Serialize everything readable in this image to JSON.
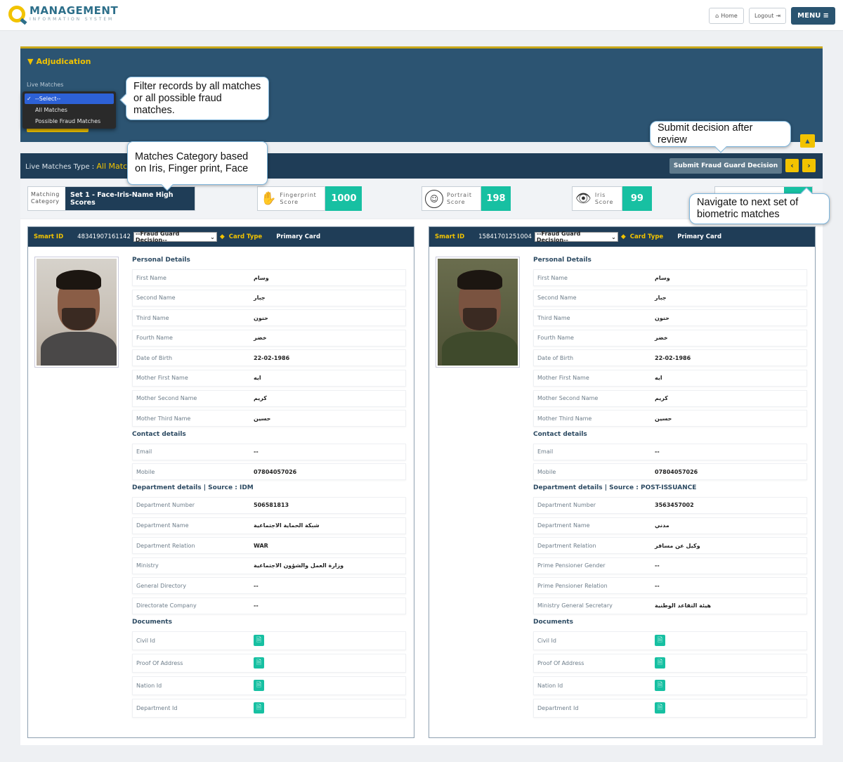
{
  "header": {
    "logo_main": "MANAGEMENT",
    "logo_sub": "INFORMATION SYSTEM",
    "home_label": "Home",
    "logout_label": "Logout",
    "menu_label": "MENU"
  },
  "adjudication": {
    "title": "Adjudication",
    "live_matches_label": "Live Matches",
    "dropdown_options": [
      "--Select--",
      "All Matches",
      "Possible Fraud Matches"
    ],
    "selected_option": "--Select--"
  },
  "live_bar": {
    "type_label": "Live Matches Type : ",
    "type_value": "All Matches",
    "submit_label": "Submit Fraud Guard Decision",
    "prev_icon": "chevron-left",
    "next_icon": "chevron-right"
  },
  "scores": {
    "matching_category_label": "Matching Category",
    "matching_category_value": "Set 1 - Face-Iris-Name High Scores",
    "fingerprint_label": "Fingerprint Score",
    "fingerprint_value": "1000",
    "portrait_label": "Portrait Score",
    "portrait_value": "198",
    "iris_label": "Iris Score",
    "iris_value": "99"
  },
  "callouts": {
    "filter": "Filter records by all matches or all possible fraud matches.",
    "category": "Matches Category based on Iris, Finger print, Face",
    "submit": "Submit decision after review",
    "navigate": "Navigate to next set of biometric matches"
  },
  "records": [
    {
      "smart_id_label": "Smart ID",
      "smart_id": "48341907161142",
      "decision": "--Fraud Guard Decision--",
      "card_type_label": "Card Type",
      "card_type": "Primary Card",
      "personal_title": "Personal Details",
      "personal": [
        {
          "label": "First Name",
          "value": "وسام"
        },
        {
          "label": "Second Name",
          "value": "جبار"
        },
        {
          "label": "Third Name",
          "value": "حنون"
        },
        {
          "label": "Fourth Name",
          "value": "خضر"
        },
        {
          "label": "Date of Birth",
          "value": "22-02-1986"
        },
        {
          "label": "Mother First Name",
          "value": "ايه"
        },
        {
          "label": "Mother Second Name",
          "value": "كريم"
        },
        {
          "label": "Mother Third Name",
          "value": "حسين"
        }
      ],
      "contact_title": "Contact details",
      "contact": [
        {
          "label": "Email",
          "value": "--"
        },
        {
          "label": "Mobile",
          "value": "07804057026"
        }
      ],
      "department_title": "Department details | Source : IDM",
      "department": [
        {
          "label": "Department Number",
          "value": "506581813"
        },
        {
          "label": "Department Name",
          "value": "شبكة الحماية الاجتماعية"
        },
        {
          "label": "Department Relation",
          "value": "WAR"
        },
        {
          "label": "Ministry",
          "value": "وزارة العمل والشؤون الاجتماعية"
        },
        {
          "label": "General Directory",
          "value": "--"
        },
        {
          "label": "Directorate Company",
          "value": "--"
        }
      ],
      "documents_title": "Documents",
      "documents": [
        {
          "label": "Civil Id"
        },
        {
          "label": "Proof Of Address"
        },
        {
          "label": "Nation Id"
        },
        {
          "label": "Department Id"
        }
      ]
    },
    {
      "smart_id_label": "Smart ID",
      "smart_id": "15841701251004",
      "decision": "--Fraud Guard Decision--",
      "card_type_label": "Card Type",
      "card_type": "Primary Card",
      "personal_title": "Personal Details",
      "personal": [
        {
          "label": "First Name",
          "value": "وسام"
        },
        {
          "label": "Second Name",
          "value": "جبار"
        },
        {
          "label": "Third Name",
          "value": "حنون"
        },
        {
          "label": "Fourth Name",
          "value": "خضر"
        },
        {
          "label": "Date of Birth",
          "value": "22-02-1986"
        },
        {
          "label": "Mother First Name",
          "value": "ايه"
        },
        {
          "label": "Mother Second Name",
          "value": "كريم"
        },
        {
          "label": "Mother Third Name",
          "value": "حسين"
        }
      ],
      "contact_title": "Contact details",
      "contact": [
        {
          "label": "Email",
          "value": "--"
        },
        {
          "label": "Mobile",
          "value": "07804057026"
        }
      ],
      "department_title": "Department details | Source : POST-ISSUANCE",
      "department": [
        {
          "label": "Department Number",
          "value": "3563457002"
        },
        {
          "label": "Department Name",
          "value": "مدني"
        },
        {
          "label": "Department Relation",
          "value": "وكيل عن مسافر"
        },
        {
          "label": "Prime Pensioner Gender",
          "value": "--"
        },
        {
          "label": "Prime Pensioner Relation",
          "value": "--"
        },
        {
          "label": "Ministry General Secretary",
          "value": "هيئة التقاعد الوطنية"
        }
      ],
      "documents_title": "Documents",
      "documents": [
        {
          "label": "Civil Id"
        },
        {
          "label": "Proof Of Address"
        },
        {
          "label": "Nation Id"
        },
        {
          "label": "Department Id"
        }
      ]
    }
  ]
}
